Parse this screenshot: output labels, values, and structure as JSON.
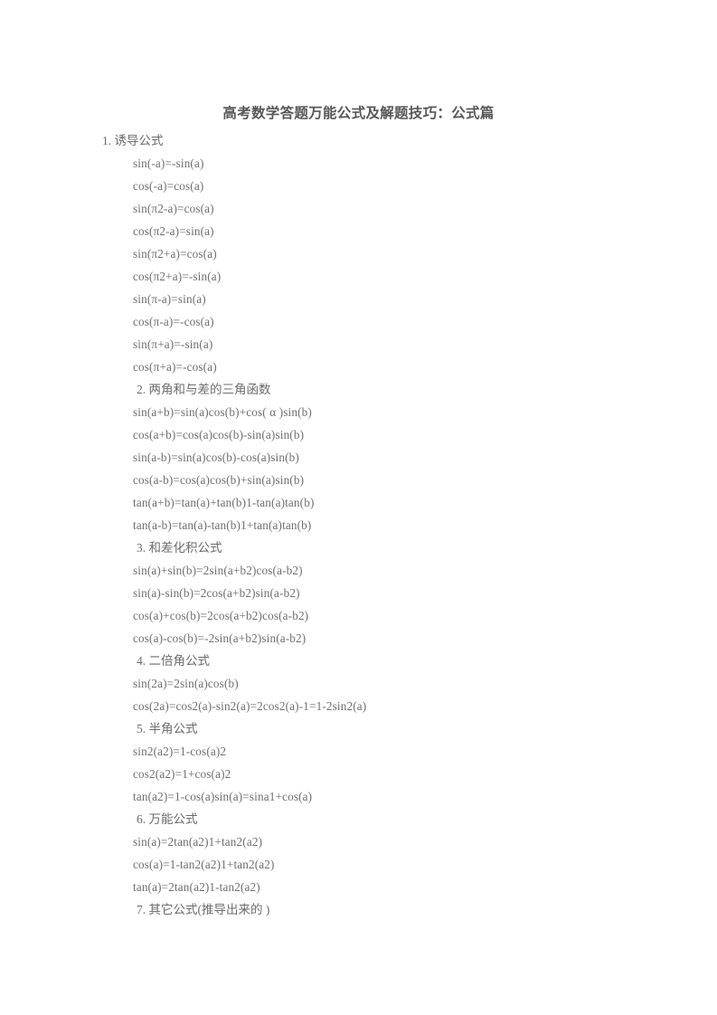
{
  "document": {
    "title": "高考数学答题万能公式及解题技巧：公式篇",
    "sections": [
      {
        "heading": "1. 诱导公式",
        "formulas": [
          "sin(-a)=-sin(a)",
          "cos(-a)=cos(a)",
          "sin(π2-a)=cos(a)",
          "cos(π2-a)=sin(a)",
          "sin(π2+a)=cos(a)",
          "cos(π2+a)=-sin(a)",
          "sin(π-a)=sin(a)",
          "cos(π-a)=-cos(a)",
          "sin(π+a)=-sin(a)",
          "cos(π+a)=-cos(a)"
        ]
      },
      {
        "heading": "2. 两角和与差的三角函数",
        "formulas": [
          "sin(a+b)=sin(a)cos(b)+cos( α )sin(b)",
          "cos(a+b)=cos(a)cos(b)-sin(a)sin(b)",
          "sin(a-b)=sin(a)cos(b)-cos(a)sin(b)",
          "cos(a-b)=cos(a)cos(b)+sin(a)sin(b)",
          "tan(a+b)=tan(a)+tan(b)1-tan(a)tan(b)",
          "tan(a-b)=tan(a)-tan(b)1+tan(a)tan(b)"
        ]
      },
      {
        "heading": "3. 和差化积公式",
        "formulas": [
          "sin(a)+sin(b)=2sin(a+b2)cos(a-b2)",
          "sin(a)-sin(b)=2cos(a+b2)sin(a-b2)",
          "cos(a)+cos(b)=2cos(a+b2)cos(a-b2)",
          "cos(a)-cos(b)=-2sin(a+b2)sin(a-b2)"
        ]
      },
      {
        "heading": "4. 二倍角公式",
        "formulas": [
          "sin(2a)=2sin(a)cos(b)",
          "cos(2a)=cos2(a)-sin2(a)=2cos2(a)-1=1-2sin2(a)"
        ]
      },
      {
        "heading": "5. 半角公式",
        "formulas": [
          "sin2(a2)=1-cos(a)2",
          "cos2(a2)=1+cos(a)2",
          "tan(a2)=1-cos(a)sin(a)=sina1+cos(a)"
        ]
      },
      {
        "heading": "6. 万能公式",
        "formulas": [
          "sin(a)=2tan(a2)1+tan2(a2)",
          "cos(a)=1-tan2(a2)1+tan2(a2)",
          "tan(a)=2tan(a2)1-tan2(a2)"
        ]
      },
      {
        "heading": "7. 其它公式(推导出来的 )",
        "formulas": []
      }
    ]
  },
  "colors": {
    "page_background": "#ffffff",
    "title_text": "#575757",
    "body_text": "#6e6e6e"
  }
}
